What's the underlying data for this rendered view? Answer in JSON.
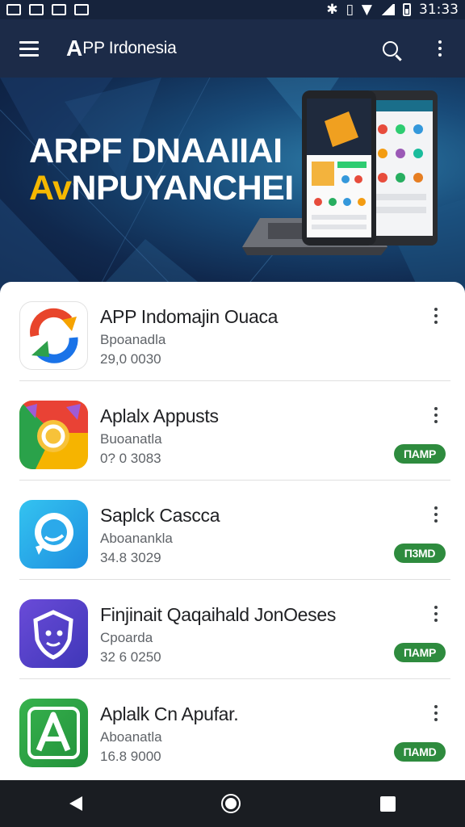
{
  "status_bar": {
    "time": "31:33",
    "left_icons": [
      "notification-icon",
      "notification-icon",
      "notification-icon",
      "notification-icon"
    ],
    "right_icons": [
      "bluetooth-icon",
      "vibrate-icon",
      "wifi-icon",
      "signal-icon",
      "battery-icon"
    ]
  },
  "app_bar": {
    "logo_mark": "A",
    "title": "PP Irdonesia",
    "menu_icon": "hamburger-menu-icon",
    "search_icon": "search-icon",
    "overflow_icon": "more-vert-icon"
  },
  "banner": {
    "line1": "ARPF DNAAIIAI",
    "line2_a": "A",
    "line2_b": "v",
    "line2_c": "NP",
    "line2_d": "UYANCHEI"
  },
  "apps": [
    {
      "name": "APP Indomajin Ouaca",
      "subtitle": "Bpoanadla",
      "size": "29,0 0030",
      "badge": "",
      "icon": "colorful-refresh-app-icon"
    },
    {
      "name": "Aplalx Appusts",
      "subtitle": "Buoanatla",
      "size": "0? 0 3083",
      "badge": "ΠAMP",
      "icon": "chrome-style-app-icon"
    },
    {
      "name": "Saplck Cascca",
      "subtitle": "Aboanankla",
      "size": "34.8 3029",
      "badge": "Π3MD",
      "icon": "chat-bubble-app-icon"
    },
    {
      "name": "Finjinait Qaqaihald JonOeses",
      "subtitle": "Cpoarda",
      "size": "32 6 0250",
      "badge": "ΠAMP",
      "icon": "shield-app-icon"
    },
    {
      "name": "Aplalk Cn Apufar.",
      "subtitle": "Aboanatla",
      "size": "16.8 9000",
      "badge": "ΠAMD",
      "icon": "letter-a-app-icon"
    }
  ],
  "nav_bar": {
    "back_icon": "back-triangle-icon",
    "home_icon": "home-circle-icon",
    "recents_icon": "recents-square-icon"
  },
  "colors": {
    "app_bar": "#1c2b48",
    "badge_green": "#2e8b3e",
    "accent_yellow": "#f5b800"
  }
}
